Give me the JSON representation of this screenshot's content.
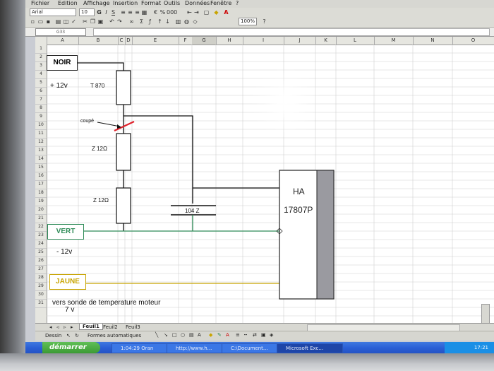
{
  "menu": {
    "items": [
      "Fichier",
      "Edition",
      "Affichage",
      "Insertion",
      "Format",
      "Outils",
      "Données",
      "Fenêtre",
      "?"
    ]
  },
  "toolbar": {
    "font_name": "Arial",
    "font_size": "10",
    "zoom": "100%"
  },
  "formula_bar": {
    "name_box": "G33"
  },
  "columns": [
    "A",
    "B",
    "C",
    "D",
    "E",
    "F",
    "G",
    "H",
    "I",
    "J",
    "K",
    "L",
    "M",
    "N",
    "O"
  ],
  "selected_column": "G",
  "rows": [
    "1",
    "2",
    "3",
    "4",
    "5",
    "6",
    "7",
    "8",
    "9",
    "10",
    "11",
    "12",
    "13",
    "14",
    "15",
    "16",
    "17",
    "18",
    "19",
    "20",
    "21",
    "22",
    "23",
    "24",
    "25",
    "26",
    "27",
    "28",
    "29",
    "30",
    "31"
  ],
  "diagram": {
    "noir": "NOIR",
    "plus_12v": "+ 12v",
    "t870": "T 870",
    "coupe": "coupé",
    "z12_a": "Z 12Ω",
    "z12_b": "Z 12Ω",
    "cap": "104 Z",
    "ha": "HA",
    "part": "17807P",
    "vert": "VERT",
    "minus_12v": "- 12v",
    "jaune": "JAUNE",
    "sonde": "vers sonde de temperature moteur",
    "sept_v": "7 v",
    "colors": {
      "vert": "#2e8b57",
      "jaune": "#c8a400",
      "red": "#e0202a"
    }
  },
  "sheet_tabs": [
    "Feuil1",
    "Feuil2",
    "Feuil3"
  ],
  "active_tab": "Feuil1",
  "drawing_toolbar": {
    "dessin": "Dessin",
    "formes": "Formes automatiques"
  },
  "taskbar": {
    "start": "démarrer",
    "tasks": [
      "1:04:29 Oran",
      "http://www.h...",
      "C:\\Document...",
      "Microsoft Exc..."
    ],
    "clock": "17:21"
  }
}
